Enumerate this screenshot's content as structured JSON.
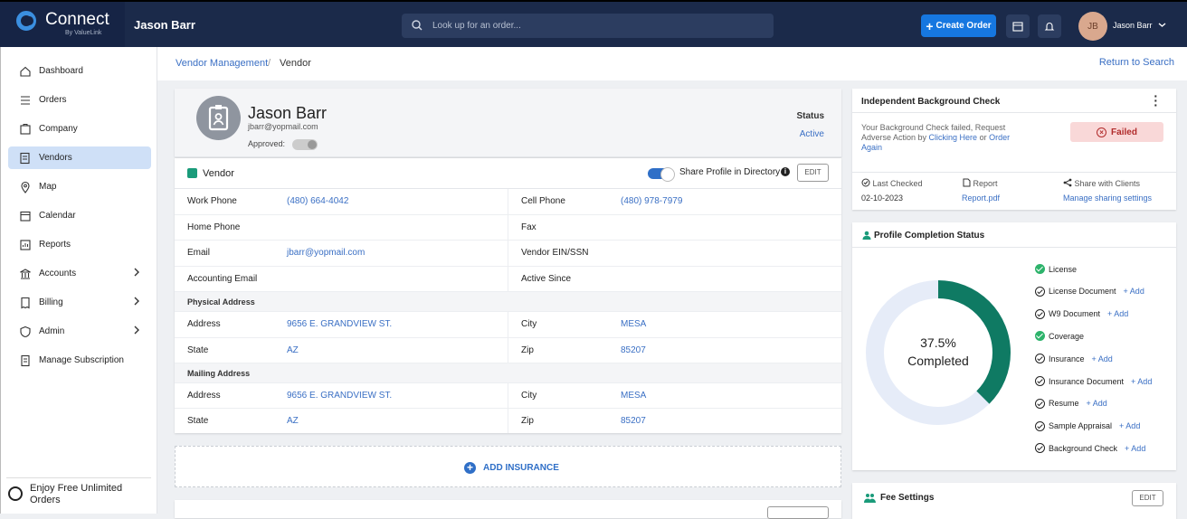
{
  "brand": {
    "name": "Connect",
    "byline": "By ValueLink"
  },
  "header": {
    "user_name": "Jason Barr",
    "search_placeholder": "Look up for an order...",
    "create_order": "Create Order",
    "avatar_initials": "JB",
    "account_name": "Jason Barr"
  },
  "sidebar": {
    "items": [
      {
        "label": "Dashboard"
      },
      {
        "label": "Orders"
      },
      {
        "label": "Company"
      },
      {
        "label": "Vendors"
      },
      {
        "label": "Map"
      },
      {
        "label": "Calendar"
      },
      {
        "label": "Reports"
      },
      {
        "label": "Accounts"
      },
      {
        "label": "Billing"
      },
      {
        "label": "Admin"
      },
      {
        "label": "Manage Subscription"
      }
    ],
    "promo": "Enjoy Free Unlimited Orders"
  },
  "breadcrumb": {
    "parent": "Vendor Management",
    "separator": "/",
    "current": "Vendor",
    "return_link": "Return to Search"
  },
  "profile": {
    "name": "Jason Barr",
    "email": "jbarr@yopmail.com",
    "approved_label": "Approved:",
    "status_label": "Status",
    "status_value": "Active"
  },
  "vendor": {
    "title": "Vendor",
    "share_label": "Share Profile in Directory",
    "edit": "EDIT",
    "fields": {
      "work_phone_label": "Work Phone",
      "work_phone": "(480) 664-4042",
      "cell_phone_label": "Cell Phone",
      "cell_phone": "(480) 978-7979",
      "home_phone_label": "Home Phone",
      "fax_label": "Fax",
      "email_label": "Email",
      "email": "jbarr@yopmail.com",
      "ein_label": "Vendor EIN/SSN",
      "accounting_email_label": "Accounting Email",
      "active_since_label": "Active Since"
    },
    "physical": {
      "heading": "Physical Address",
      "address_label": "Address",
      "address": "9656 E. GRANDVIEW ST.",
      "city_label": "City",
      "city": "MESA",
      "state_label": "State",
      "state": "AZ",
      "zip_label": "Zip",
      "zip": "85207"
    },
    "mailing": {
      "heading": "Mailing Address",
      "address_label": "Address",
      "address": "9656 E. GRANDVIEW ST.",
      "city_label": "City",
      "city": "MESA",
      "state_label": "State",
      "state": "AZ",
      "zip_label": "Zip",
      "zip": "85207"
    }
  },
  "add_insurance": "ADD INSURANCE",
  "background_check": {
    "title": "Independent Background Check",
    "message_pre": "Your Background Check failed, Request Adverse Action by ",
    "link1": "Clicking Here",
    "message_mid": " or ",
    "link2": "Order Again",
    "status": "Failed",
    "last_checked_label": "Last Checked",
    "last_checked_value": "02-10-2023",
    "report_label": "Report",
    "report_value": "Report.pdf",
    "share_label": "Share with Clients",
    "share_value": "Manage sharing settings"
  },
  "profile_completion": {
    "title": "Profile Completion Status",
    "percent_text": "37.5%",
    "completed_label": "Completed",
    "percent": 37.5,
    "colors": {
      "done": "#0f7a63",
      "remaining": "#e6ecf8"
    },
    "items": [
      {
        "label": "License",
        "done": true,
        "add": ""
      },
      {
        "label": "License Document",
        "done": false,
        "add": "+ Add"
      },
      {
        "label": "W9 Document",
        "done": false,
        "add": "+ Add"
      },
      {
        "label": "Coverage",
        "done": true,
        "add": ""
      },
      {
        "label": "Insurance",
        "done": false,
        "add": "+ Add"
      },
      {
        "label": "Insurance Document",
        "done": false,
        "add": "+ Add"
      },
      {
        "label": "Resume",
        "done": false,
        "add": "+ Add"
      },
      {
        "label": "Sample Appraisal",
        "done": false,
        "add": "+ Add"
      },
      {
        "label": "Background Check",
        "done": false,
        "add": "+ Add"
      }
    ]
  },
  "fee_settings": {
    "title": "Fee Settings",
    "edit": "EDIT"
  },
  "icons": {
    "dashboard": "home-icon",
    "orders": "list-icon",
    "company": "building-icon",
    "vendors": "vendor-icon",
    "map": "map-pin-icon",
    "calendar": "calendar-icon",
    "reports": "reports-icon",
    "accounts": "bank-icon",
    "billing": "receipt-icon",
    "admin": "shield-icon",
    "subscription": "document-icon"
  }
}
